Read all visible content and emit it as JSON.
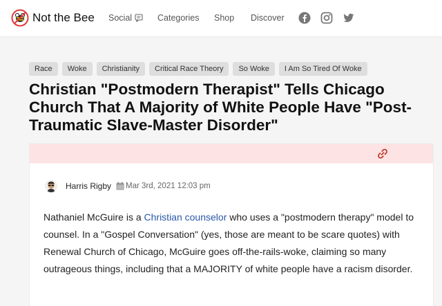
{
  "brand": {
    "name": "Not the Bee",
    "accent": "#e03a3a"
  },
  "nav": {
    "social": "Social",
    "categories": "Categories",
    "shop": "Shop",
    "discover": "Discover"
  },
  "social_icons": [
    "facebook-icon",
    "instagram-icon",
    "twitter-icon"
  ],
  "tags": [
    "Race",
    "Woke",
    "Christianity",
    "Critical Race Theory",
    "So Woke",
    "I Am So Tired Of Woke"
  ],
  "article": {
    "title": "Christian \"Postmodern Therapist\" Tells Chicago Church That A Majority of White People Have \"Post-Traumatic Slave-Master Disorder\"",
    "author": "Harris Rigby",
    "date": "Mar 3rd, 2021 12:03 pm",
    "body_before": "Nathaniel McGuire is a ",
    "body_link": "Christian counselor",
    "body_after": " who uses a \"postmodern therapy\" model to counsel. In a \"Gospel Conversation\" (yes, those are meant to be scare quotes) with Renewal Church of Chicago, McGuire goes off-the-rails-woke, claiming so many outrageous things, including that a MAJORITY of white people have a racism disorder."
  }
}
